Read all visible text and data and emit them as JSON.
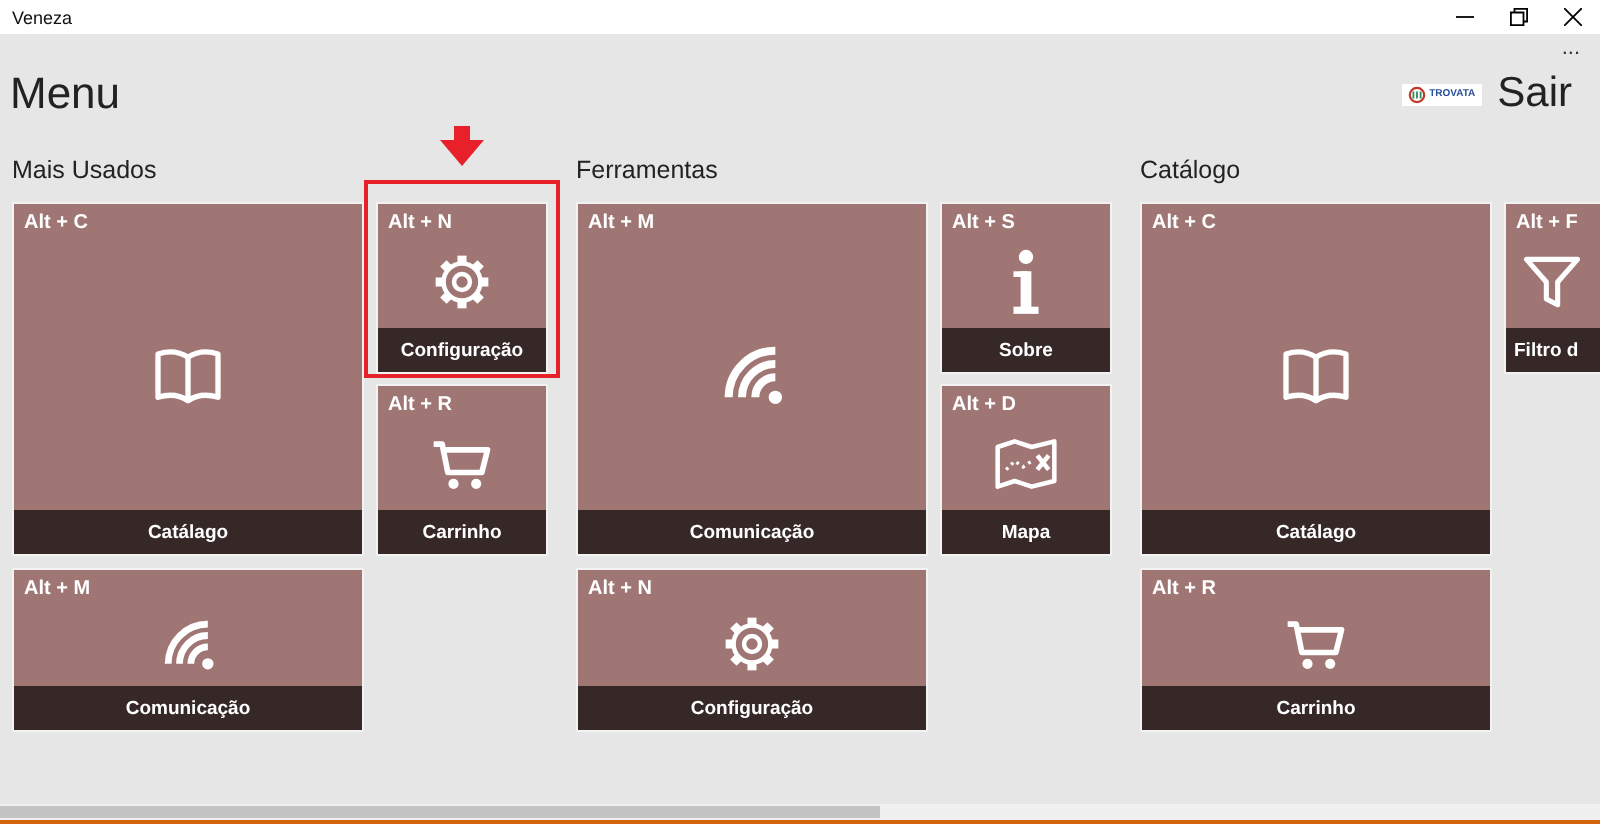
{
  "window": {
    "title": "Veneza"
  },
  "app_bar": {
    "more": "..."
  },
  "header": {
    "title": "Menu",
    "logo_text": "TROVATA",
    "exit_label": "Sair"
  },
  "groups": [
    {
      "title": "Mais Usados",
      "tiles": [
        {
          "kind": "book",
          "shortcut": "Alt + C",
          "label": "Catálago",
          "highlighted": false,
          "cut_off": false
        },
        {
          "kind": "gear",
          "shortcut": "Alt + N",
          "label": "Configuração",
          "highlighted": true,
          "cut_off": false
        },
        {
          "kind": "cart",
          "shortcut": "Alt + R",
          "label": "Carrinho",
          "highlighted": false,
          "cut_off": false
        },
        {
          "kind": "signal",
          "shortcut": "Alt + M",
          "label": "Comunicação",
          "highlighted": false,
          "cut_off": false
        }
      ]
    },
    {
      "title": "Ferramentas",
      "tiles": [
        {
          "kind": "signal",
          "shortcut": "Alt + M",
          "label": "Comunicação",
          "highlighted": false,
          "cut_off": false
        },
        {
          "kind": "info",
          "shortcut": "Alt + S",
          "label": "Sobre",
          "highlighted": false,
          "cut_off": false
        },
        {
          "kind": "map",
          "shortcut": "Alt + D",
          "label": "Mapa",
          "highlighted": false,
          "cut_off": false
        },
        {
          "kind": "gear",
          "shortcut": "Alt + N",
          "label": "Configuração",
          "highlighted": false,
          "cut_off": false
        }
      ]
    },
    {
      "title": "Catálogo",
      "tiles": [
        {
          "kind": "book",
          "shortcut": "Alt + C",
          "label": "Catálago",
          "highlighted": false,
          "cut_off": false
        },
        {
          "kind": "funnel",
          "shortcut": "Alt + F",
          "label": "Filtro d",
          "highlighted": false,
          "cut_off": true
        },
        {
          "kind": "cart",
          "shortcut": "Alt + R",
          "label": "Carrinho",
          "highlighted": false,
          "cut_off": false
        }
      ]
    }
  ]
}
